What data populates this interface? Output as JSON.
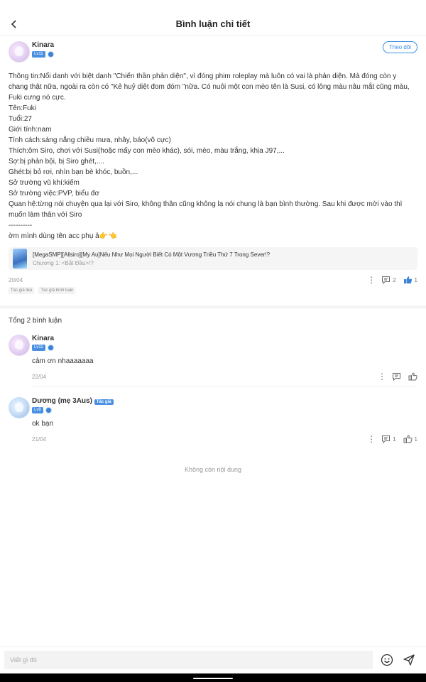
{
  "header": {
    "title": "Bình luận chi tiết"
  },
  "post": {
    "author": {
      "name": "Kinara",
      "level": "Lv11"
    },
    "follow_label": "Theo dõi",
    "content": "Thông tin:Nổi danh với biệt danh \"Chiến thần phản diện\", vì đóng phim roleplay mà luôn có vai là phản diện. Mà đóng còn y chang thật nữa, ngoài ra còn có \"Kẻ huỷ diệt đom đóm \"nữa. Có nuôi một con mèo tên là Susi, có lông màu nâu mắt cũng màu, Fuki cưng nó cực.\nTên:Fuki\nTuổi:27\nGiới tính:nam\nTính cách:sáng nắng chiều mưa, nhây, báo(vô cực)\nThích:ôm Siro, chơi với Susi(hoặc mấy con mèo khác), sói, mèo, màu trắng, khịa J97,...\nSợ:bị phản bội, bị Siro ghét,....\nGhét:bị bỏ rơi, nhìn bạn bè khóc, buồn,...\nSở trường vũ khí:kiếm\nSở trường việc:PVP, biểu đơ\nQuan hệ:từng nói chuyện qua lại với Siro, không thân cũng không lạ nói chung là bạn bình thường. Sau khi được mời vào thì muốn làm thân với Siro\n----------\nờm mình dùng tên acc phụ ả👉👈",
    "link_card": {
      "title": "[MegaSMP][Allsiro][My Au]Nếu Như Mọi Người Biết Có Một Vương Triều Thứ 7 Trong Sever!?",
      "subtitle": "Chương 1: <Bắt Đầu>!?"
    },
    "date": "20/04",
    "comment_count": "2",
    "like_count": "1",
    "tags": [
      "Tác giả like",
      "Tác giả bình luận"
    ]
  },
  "comments": {
    "total_label": "Tổng 2 bình luận",
    "items": [
      {
        "name": "Kinara",
        "level": "Lv11",
        "text": "cảm ơn nhaaaaaaa",
        "date": "22/04"
      },
      {
        "name": "Dương (mẹ 3Aus)",
        "level": "Lv8",
        "author_tag": "Tác giả",
        "text": "ok bạn",
        "date": "21/04",
        "reply_count": "1",
        "like_count": "1"
      }
    ]
  },
  "end_message": "Không còn nội dung",
  "input": {
    "placeholder": "Viết gì đó"
  },
  "colors": {
    "accent": "#3a8ee6",
    "like_active": "#3b82d6"
  }
}
